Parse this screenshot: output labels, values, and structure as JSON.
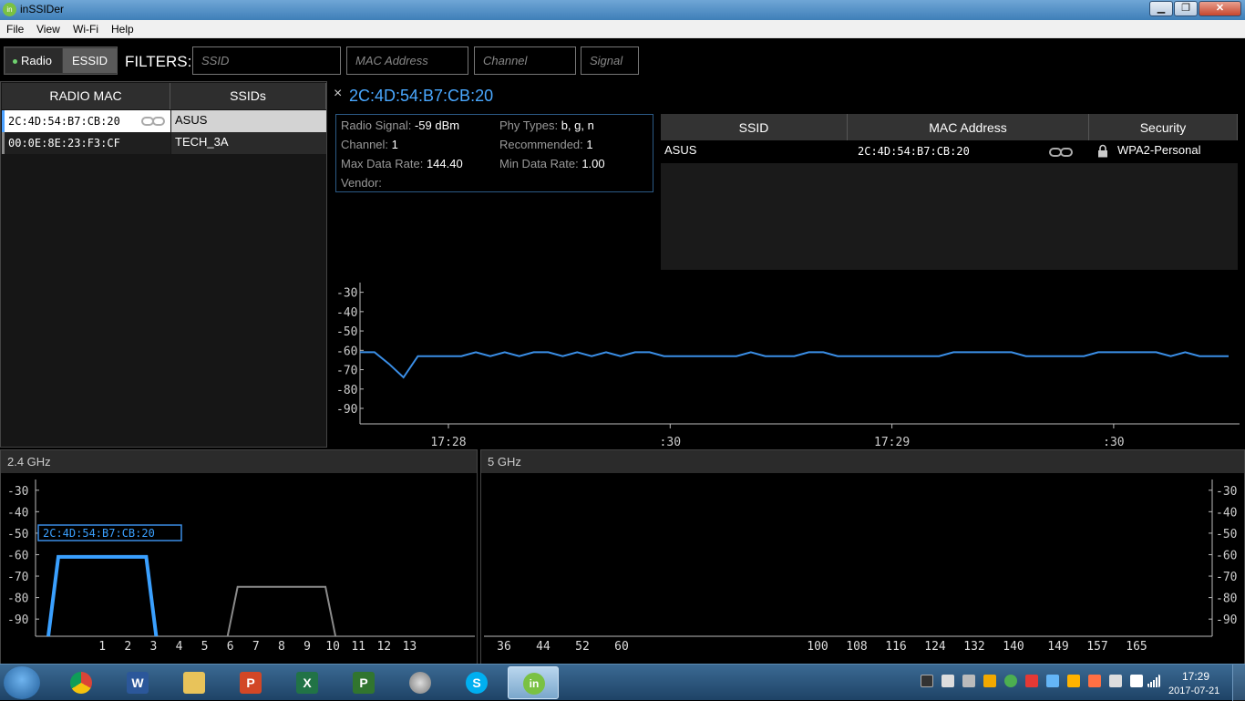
{
  "window": {
    "title": "inSSIDer",
    "icon_text": "in",
    "minimize": "▁",
    "maximize": "❐",
    "close": "✕"
  },
  "menu": [
    "File",
    "View",
    "Wi-Fi",
    "Help"
  ],
  "toolbar": {
    "toggle": {
      "radio": "Radio",
      "essid": "ESSID",
      "selected": "Radio"
    },
    "filters_label": "FILTERS:",
    "placeholders": {
      "ssid": "SSID",
      "mac": "MAC Address",
      "channel": "Channel",
      "signal": "Signal"
    }
  },
  "left_table": {
    "headers": [
      "RADIO MAC",
      "SSIDs"
    ],
    "rows": [
      {
        "mac": "2C:4D:54:B7:CB:20",
        "ssid": "ASUS",
        "linked": true
      },
      {
        "mac": "00:0E:8E:23:F3:CF",
        "ssid": "TECH_3A",
        "linked": false
      }
    ]
  },
  "detail": {
    "close": "×",
    "mac": "2C:4D:54:B7:CB:20",
    "radio_signal_label": "Radio Signal:",
    "radio_signal": "-59 dBm",
    "phy_types_label": "Phy Types:",
    "phy_types": "b, g, n",
    "channel_label": "Channel:",
    "channel": "1",
    "recommended_label": "Recommended:",
    "recommended": "1",
    "max_rate_label": "Max Data Rate:",
    "max_rate": "144.40",
    "min_rate_label": "Min Data Rate:",
    "min_rate": "1.00",
    "vendor_label": "Vendor:",
    "vendor": ""
  },
  "ssid_table": {
    "headers": [
      "SSID",
      "MAC Address",
      "Security"
    ],
    "rows": [
      {
        "ssid": "ASUS",
        "mac": "2C:4D:54:B7:CB:20",
        "security": "WPA2-Personal"
      }
    ]
  },
  "time_chart": {
    "y_ticks": [
      "-30",
      "-40",
      "-50",
      "-60",
      "-70",
      "-80",
      "-90"
    ],
    "y_range": [
      -98,
      -25
    ],
    "x_labels": [
      "17:28",
      ":30",
      "17:29",
      ":30"
    ],
    "color": "#3a8ee6",
    "signal": [
      -61,
      -61,
      -67,
      -74,
      -63,
      -63,
      -63,
      -63,
      -61,
      -63,
      -61,
      -63,
      -61,
      -61,
      -63,
      -61,
      -63,
      -61,
      -63,
      -61,
      -61,
      -63,
      -63,
      -63,
      -63,
      -63,
      -63,
      -61,
      -63,
      -63,
      -63,
      -61,
      -61,
      -63,
      -63,
      -63,
      -63,
      -63,
      -63,
      -63,
      -63,
      -61,
      -61,
      -61,
      -61,
      -61,
      -63,
      -63,
      -63,
      -63,
      -63,
      -61,
      -61,
      -61,
      -61,
      -61,
      -63,
      -61,
      -63,
      -63,
      -63
    ]
  },
  "band_24": {
    "title": "2.4 GHz",
    "y_ticks": [
      "-30",
      "-40",
      "-50",
      "-60",
      "-70",
      "-80",
      "-90"
    ],
    "y_range": [
      -98,
      -25
    ],
    "channels": [
      "1",
      "2",
      "3",
      "4",
      "5",
      "6",
      "7",
      "8",
      "9",
      "10",
      "11",
      "12",
      "13"
    ],
    "networks": [
      {
        "label": "2C:4D:54:B7:CB:20",
        "channel": 1,
        "signal": -61,
        "color": "#3aa0ff"
      },
      {
        "label": "",
        "channel": 8,
        "signal": -75,
        "color": "#8a8a8a"
      }
    ]
  },
  "band_5": {
    "title": "5 GHz",
    "y_ticks": [
      "-30",
      "-40",
      "-50",
      "-60",
      "-70",
      "-80",
      "-90"
    ],
    "channels": [
      "36",
      "44",
      "52",
      "60",
      "100",
      "108",
      "116",
      "124",
      "132",
      "140",
      "149",
      "157",
      "165"
    ]
  },
  "taskbar": {
    "apps": [
      "chrome",
      "word",
      "explorer",
      "powerpoint",
      "excel",
      "project",
      "speakers",
      "skype",
      "insider"
    ],
    "app_letters": {
      "word": "W",
      "powerpoint": "P",
      "excel": "X",
      "project": "P",
      "skype": "S",
      "insider": "in"
    },
    "clock_time": "17:29",
    "clock_date": "2017-07-21"
  }
}
